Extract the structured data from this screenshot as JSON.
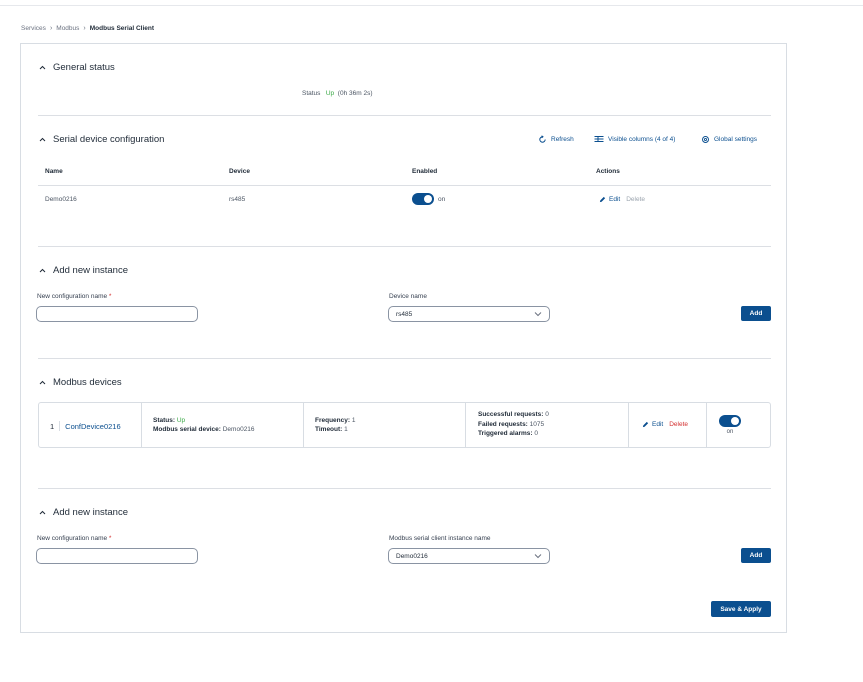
{
  "breadcrumb": [
    "Services",
    "Modbus",
    "Modbus Serial Client"
  ],
  "general_status": {
    "title": "General status",
    "status_label": "Status",
    "status_value": "Up",
    "status_uptime": "(0h 36m 2s)"
  },
  "serial_config": {
    "title": "Serial device configuration",
    "refresh_label": "Refresh",
    "visible_columns_label": "Visible columns (4 of 4)",
    "global_settings_label": "Global settings",
    "columns": [
      "Name",
      "Device",
      "Enabled",
      "Actions"
    ],
    "rows": [
      {
        "name": "Demo0216",
        "device": "rs485",
        "enabled_label": "on",
        "edit": "Edit",
        "delete": "Delete"
      }
    ]
  },
  "add_instance_1": {
    "title": "Add new instance",
    "config_name_label": "New configuration name",
    "required_mark": "*",
    "config_name_value": "",
    "device_name_label": "Device name",
    "device_name_value": "rs485",
    "add_label": "Add"
  },
  "modbus_devices": {
    "title": "Modbus devices",
    "device": {
      "index": "1",
      "name": "ConfDevice0216",
      "status_label": "Status:",
      "status_value": "Up",
      "serial_device_label": "Modbus serial device:",
      "serial_device_value": "Demo0216",
      "frequency_label": "Frequency:",
      "frequency_value": "1",
      "timeout_label": "Timeout:",
      "timeout_value": "1",
      "successful_label": "Successful requests:",
      "successful_value": "0",
      "failed_label": "Failed requests:",
      "failed_value": "1075",
      "alarms_label": "Triggered alarms:",
      "alarms_value": "0",
      "edit": "Edit",
      "delete": "Delete",
      "toggle_label": "on"
    }
  },
  "add_instance_2": {
    "title": "Add new instance",
    "config_name_label": "New configuration name",
    "required_mark": "*",
    "config_name_value": "",
    "instance_label": "Modbus serial client instance name",
    "instance_value": "Demo0216",
    "add_label": "Add"
  },
  "save_apply_label": "Save & Apply",
  "colors": {
    "primary": "#0b4f8f",
    "success": "#39a845",
    "danger": "#d32f2f"
  }
}
